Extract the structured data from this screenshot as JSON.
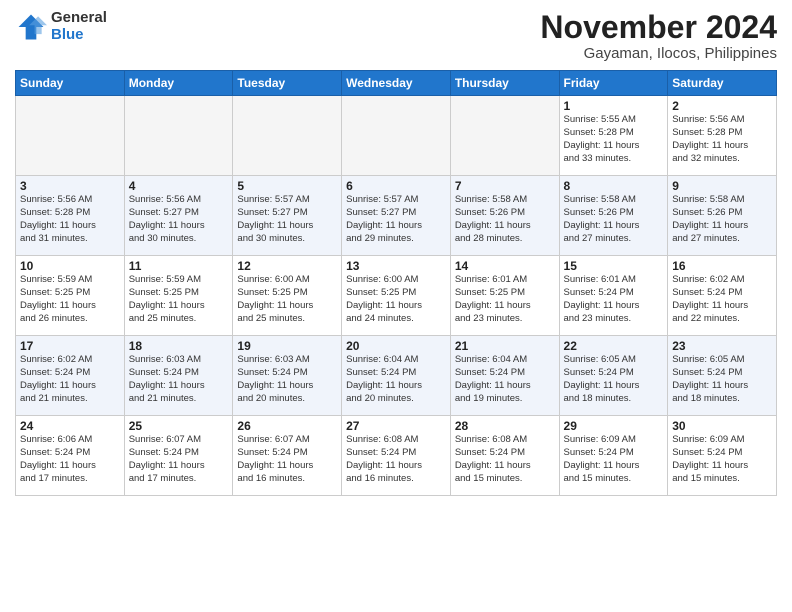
{
  "header": {
    "logo_general": "General",
    "logo_blue": "Blue",
    "title": "November 2024",
    "location": "Gayaman, Ilocos, Philippines"
  },
  "days_of_week": [
    "Sunday",
    "Monday",
    "Tuesday",
    "Wednesday",
    "Thursday",
    "Friday",
    "Saturday"
  ],
  "weeks": [
    [
      {
        "day": "",
        "info": ""
      },
      {
        "day": "",
        "info": ""
      },
      {
        "day": "",
        "info": ""
      },
      {
        "day": "",
        "info": ""
      },
      {
        "day": "",
        "info": ""
      },
      {
        "day": "1",
        "info": "Sunrise: 5:55 AM\nSunset: 5:28 PM\nDaylight: 11 hours\nand 33 minutes."
      },
      {
        "day": "2",
        "info": "Sunrise: 5:56 AM\nSunset: 5:28 PM\nDaylight: 11 hours\nand 32 minutes."
      }
    ],
    [
      {
        "day": "3",
        "info": "Sunrise: 5:56 AM\nSunset: 5:28 PM\nDaylight: 11 hours\nand 31 minutes."
      },
      {
        "day": "4",
        "info": "Sunrise: 5:56 AM\nSunset: 5:27 PM\nDaylight: 11 hours\nand 30 minutes."
      },
      {
        "day": "5",
        "info": "Sunrise: 5:57 AM\nSunset: 5:27 PM\nDaylight: 11 hours\nand 30 minutes."
      },
      {
        "day": "6",
        "info": "Sunrise: 5:57 AM\nSunset: 5:27 PM\nDaylight: 11 hours\nand 29 minutes."
      },
      {
        "day": "7",
        "info": "Sunrise: 5:58 AM\nSunset: 5:26 PM\nDaylight: 11 hours\nand 28 minutes."
      },
      {
        "day": "8",
        "info": "Sunrise: 5:58 AM\nSunset: 5:26 PM\nDaylight: 11 hours\nand 27 minutes."
      },
      {
        "day": "9",
        "info": "Sunrise: 5:58 AM\nSunset: 5:26 PM\nDaylight: 11 hours\nand 27 minutes."
      }
    ],
    [
      {
        "day": "10",
        "info": "Sunrise: 5:59 AM\nSunset: 5:25 PM\nDaylight: 11 hours\nand 26 minutes."
      },
      {
        "day": "11",
        "info": "Sunrise: 5:59 AM\nSunset: 5:25 PM\nDaylight: 11 hours\nand 25 minutes."
      },
      {
        "day": "12",
        "info": "Sunrise: 6:00 AM\nSunset: 5:25 PM\nDaylight: 11 hours\nand 25 minutes."
      },
      {
        "day": "13",
        "info": "Sunrise: 6:00 AM\nSunset: 5:25 PM\nDaylight: 11 hours\nand 24 minutes."
      },
      {
        "day": "14",
        "info": "Sunrise: 6:01 AM\nSunset: 5:25 PM\nDaylight: 11 hours\nand 23 minutes."
      },
      {
        "day": "15",
        "info": "Sunrise: 6:01 AM\nSunset: 5:24 PM\nDaylight: 11 hours\nand 23 minutes."
      },
      {
        "day": "16",
        "info": "Sunrise: 6:02 AM\nSunset: 5:24 PM\nDaylight: 11 hours\nand 22 minutes."
      }
    ],
    [
      {
        "day": "17",
        "info": "Sunrise: 6:02 AM\nSunset: 5:24 PM\nDaylight: 11 hours\nand 21 minutes."
      },
      {
        "day": "18",
        "info": "Sunrise: 6:03 AM\nSunset: 5:24 PM\nDaylight: 11 hours\nand 21 minutes."
      },
      {
        "day": "19",
        "info": "Sunrise: 6:03 AM\nSunset: 5:24 PM\nDaylight: 11 hours\nand 20 minutes."
      },
      {
        "day": "20",
        "info": "Sunrise: 6:04 AM\nSunset: 5:24 PM\nDaylight: 11 hours\nand 20 minutes."
      },
      {
        "day": "21",
        "info": "Sunrise: 6:04 AM\nSunset: 5:24 PM\nDaylight: 11 hours\nand 19 minutes."
      },
      {
        "day": "22",
        "info": "Sunrise: 6:05 AM\nSunset: 5:24 PM\nDaylight: 11 hours\nand 18 minutes."
      },
      {
        "day": "23",
        "info": "Sunrise: 6:05 AM\nSunset: 5:24 PM\nDaylight: 11 hours\nand 18 minutes."
      }
    ],
    [
      {
        "day": "24",
        "info": "Sunrise: 6:06 AM\nSunset: 5:24 PM\nDaylight: 11 hours\nand 17 minutes."
      },
      {
        "day": "25",
        "info": "Sunrise: 6:07 AM\nSunset: 5:24 PM\nDaylight: 11 hours\nand 17 minutes."
      },
      {
        "day": "26",
        "info": "Sunrise: 6:07 AM\nSunset: 5:24 PM\nDaylight: 11 hours\nand 16 minutes."
      },
      {
        "day": "27",
        "info": "Sunrise: 6:08 AM\nSunset: 5:24 PM\nDaylight: 11 hours\nand 16 minutes."
      },
      {
        "day": "28",
        "info": "Sunrise: 6:08 AM\nSunset: 5:24 PM\nDaylight: 11 hours\nand 15 minutes."
      },
      {
        "day": "29",
        "info": "Sunrise: 6:09 AM\nSunset: 5:24 PM\nDaylight: 11 hours\nand 15 minutes."
      },
      {
        "day": "30",
        "info": "Sunrise: 6:09 AM\nSunset: 5:24 PM\nDaylight: 11 hours\nand 15 minutes."
      }
    ]
  ]
}
